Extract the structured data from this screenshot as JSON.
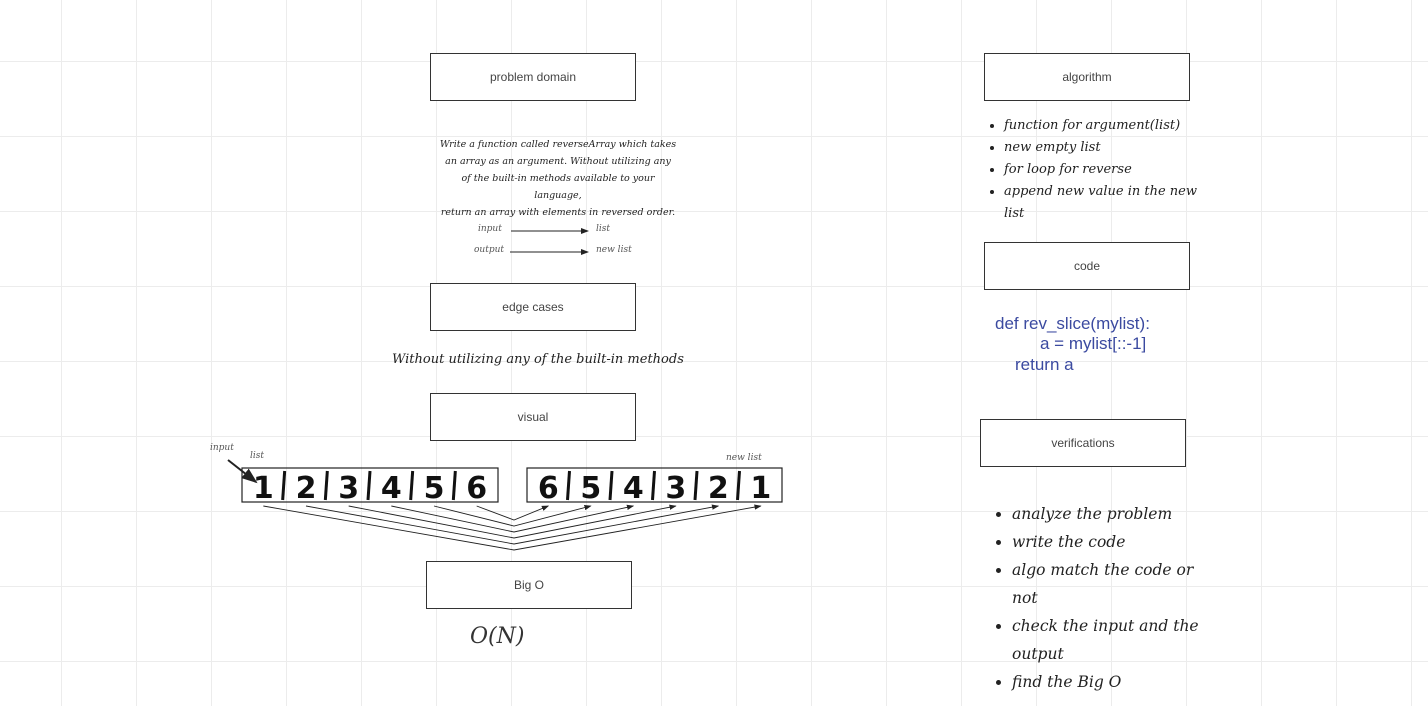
{
  "boxes": {
    "problem_domain": "problem domain",
    "edge_cases": "edge cases",
    "visual": "visual",
    "big_o": "Big O",
    "algorithm": "algorithm",
    "code": "code",
    "verifications": "verifications"
  },
  "problem": {
    "line1": "Write a function called reverseArray which takes",
    "line2": "an array as an argument. Without utilizing any",
    "line3": "of the built-in methods available to your language,",
    "line4": "return an array with elements in reversed order.",
    "input_label": "input",
    "input_value": "list",
    "output_label": "output",
    "output_value": "new list"
  },
  "edge_text": "Without utilizing any of the built-in methods",
  "visual": {
    "input_label": "input",
    "list_label": "list",
    "new_list_label": "new list",
    "input_array": [
      "1",
      "2",
      "3",
      "4",
      "5",
      "6"
    ],
    "output_array": [
      "6",
      "5",
      "4",
      "3",
      "2",
      "1"
    ]
  },
  "big_o_value": "O(N)",
  "algorithm_steps": [
    "function for argument(list)",
    "new empty list",
    "for loop for reverse",
    "append new value in the new list"
  ],
  "code": {
    "line1": "def rev_slice(mylist):",
    "line2": "a = mylist[::-1]",
    "line3": "return a"
  },
  "verification_steps": [
    "analyze the problem",
    "write the code",
    "algo match the code or not",
    "check the input and the output",
    "find the Big O"
  ]
}
